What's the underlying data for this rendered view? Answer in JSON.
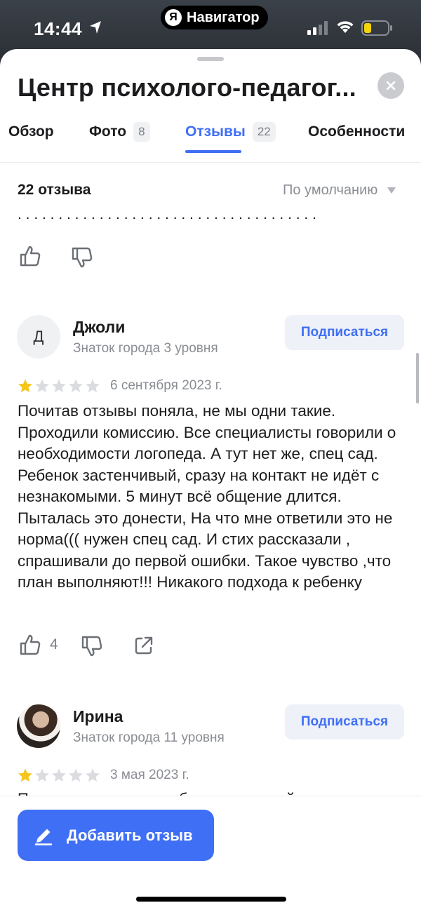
{
  "status_bar": {
    "time": "14:44",
    "app_pill_logo": "Я",
    "app_pill_label": "Навигатор",
    "icons": [
      "location-arrow-icon",
      "cellular-signal-icon",
      "wifi-icon",
      "battery-low-icon"
    ]
  },
  "header": {
    "title": "Центр психолого-педагог...",
    "close_icon": "close-icon"
  },
  "tabs": [
    {
      "label": "Обзор",
      "count": ""
    },
    {
      "label": "Фото",
      "count": "8"
    },
    {
      "label": "Отзывы",
      "count": "22",
      "active": true
    },
    {
      "label": "Особенности",
      "count": ""
    }
  ],
  "reviews_header": {
    "count_label": "22 отзыва",
    "sort_label": "По умолчанию"
  },
  "reviews": [
    {
      "avatar_letter": "Д",
      "author": "Джоли",
      "level": "Знаток города 3 уровня",
      "subscribe_label": "Подписаться",
      "rating": 1,
      "rating_max": 5,
      "date": "6 сентября 2023 г.",
      "text": "Почитав отзывы поняла, не мы одни такие. Проходили комиссию. Все специалисты говорили о необходимости логопеда. А тут нет же, спец сад. Ребенок застенчивый, сразу на контакт не идёт с незнакомыми. 5 минут всё общение длится. Пыталась это донести, На что мне ответили это не норма((( нужен спец сад. И стих рассказали , спрашивали до первой ошибки. Такое чувство ,что план выполняют!!! Никакого подхода к ребенку",
      "likes": "4"
    },
    {
      "author": "Ирина",
      "level": "Знаток города 11 уровня",
      "subscribe_label": "Подписаться",
      "rating": 1,
      "rating_max": 5,
      "date": "3 мая 2023 г."
    }
  ],
  "footer": {
    "add_review_label": "Добавить отзыв"
  },
  "colors": {
    "accent": "#3f6ff5",
    "star_filled": "#f5c518",
    "star_empty": "#dadce0"
  }
}
